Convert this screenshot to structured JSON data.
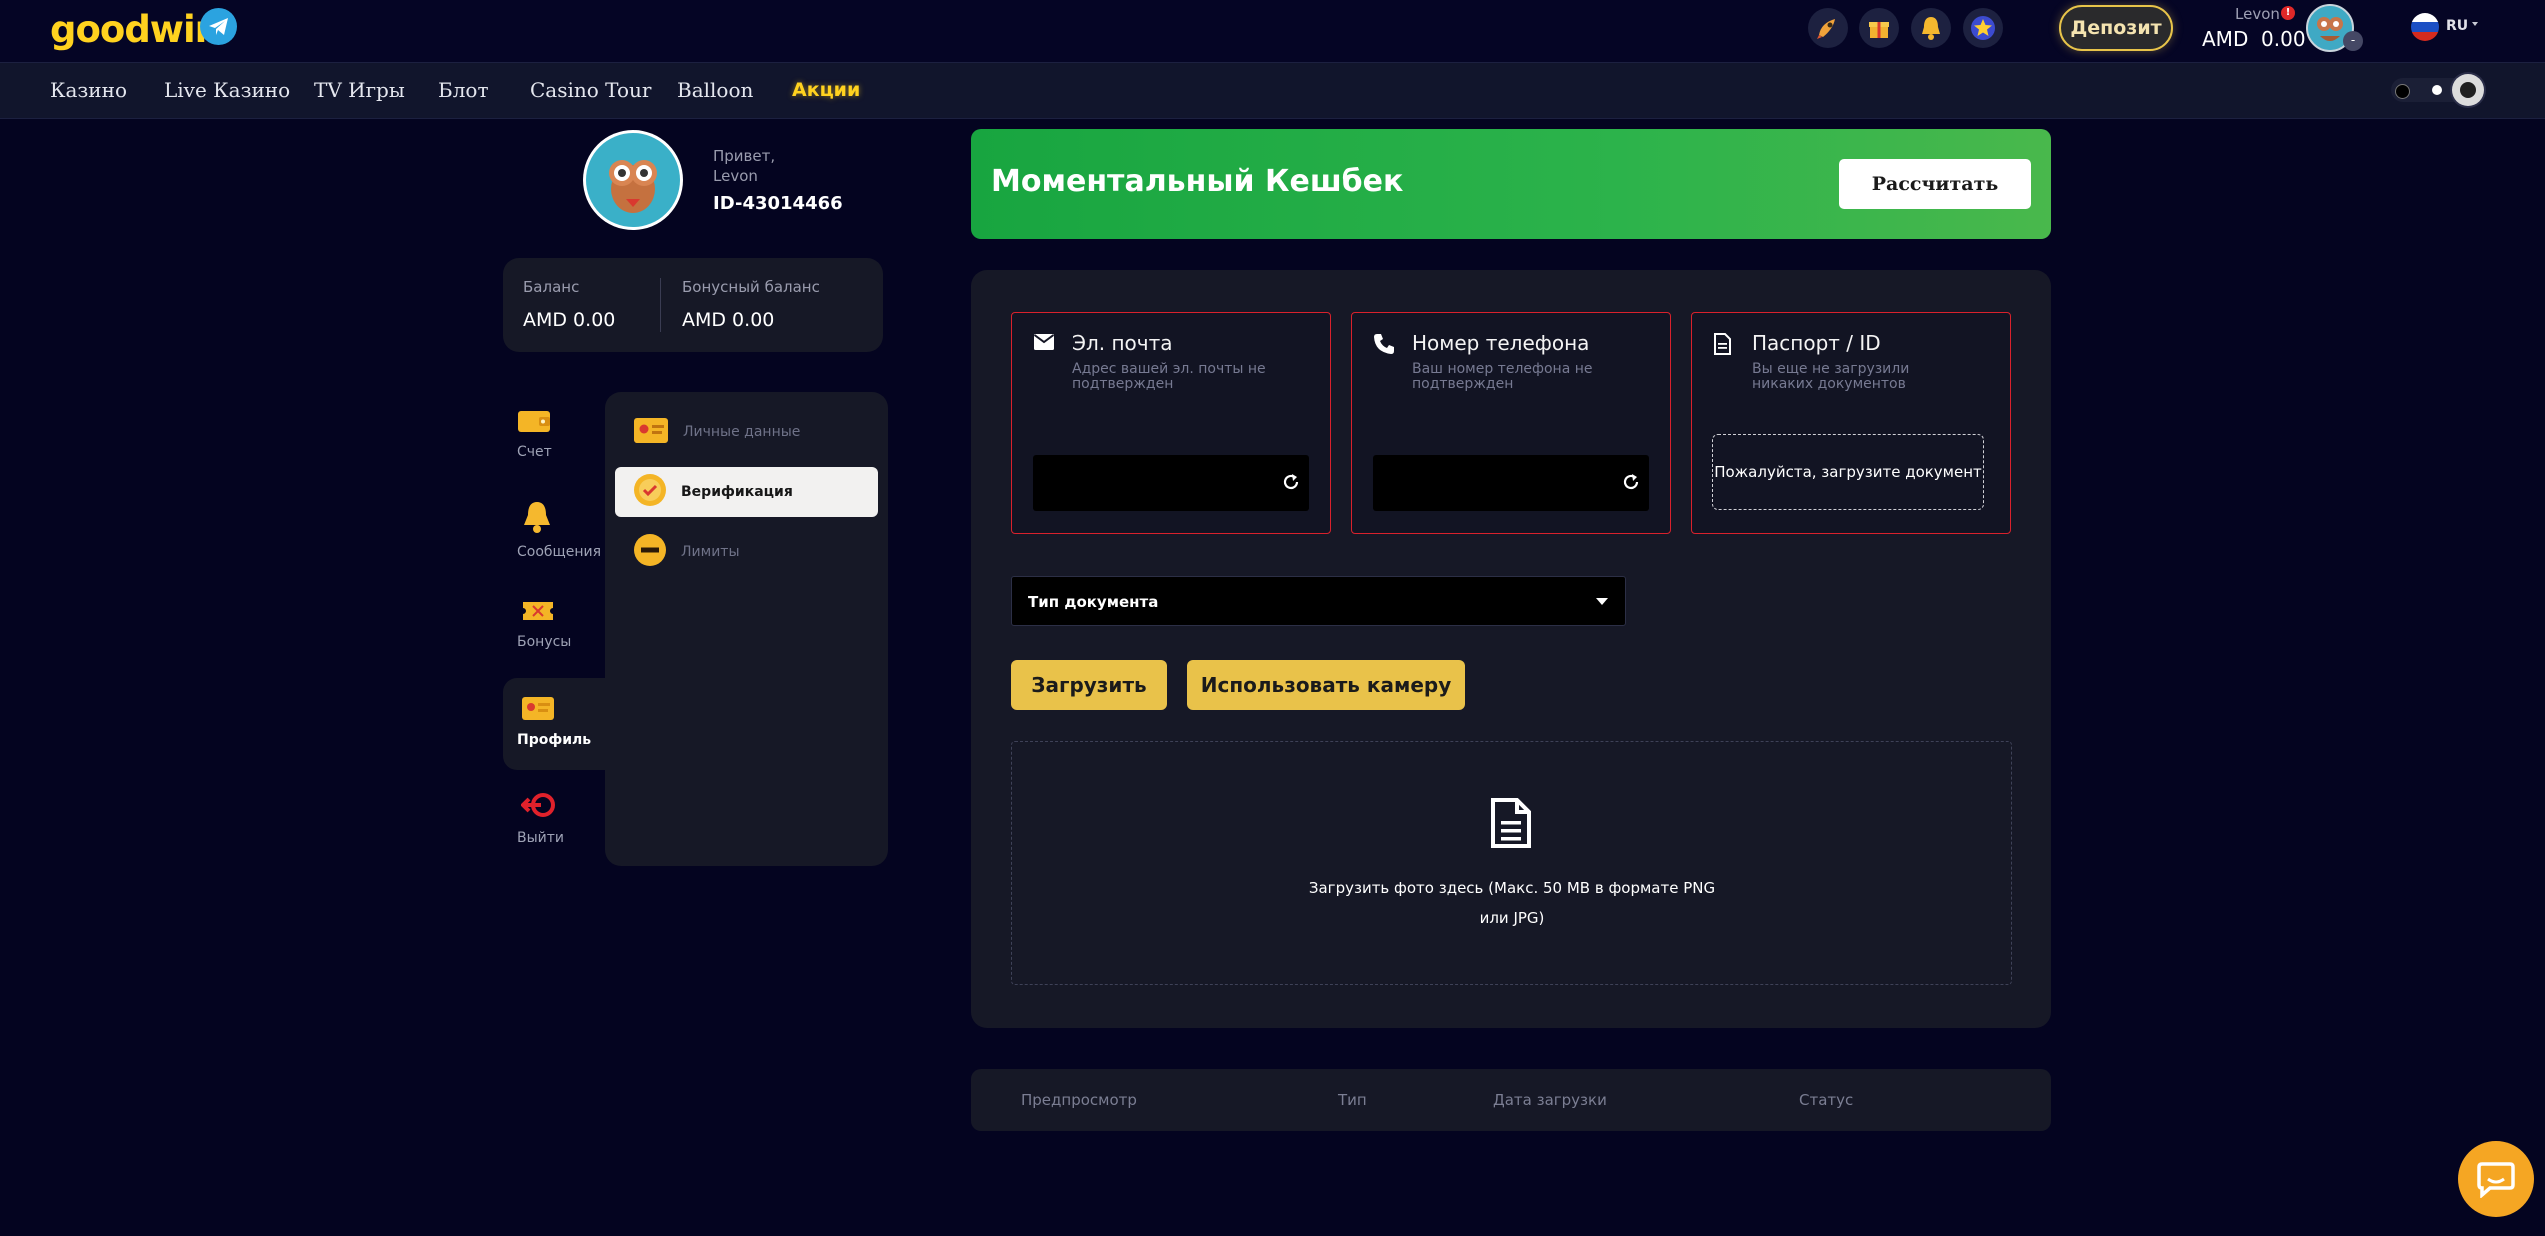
{
  "header": {
    "logo_text": "goodwin",
    "deposit_label": "Депозит",
    "username": "Levon",
    "balance": "AMD  0.00",
    "language": "RU"
  },
  "nav": {
    "items": [
      "Казино",
      "Live Казино",
      "TV Игры",
      "Блот",
      "Casino Tour",
      "Balloon",
      "Акции"
    ]
  },
  "profile": {
    "greeting": "Привет,",
    "name": "Levon",
    "id": "ID-43014466",
    "balance_label": "Баланс",
    "balance_value": "AMD 0.00",
    "bonus_label": "Бонусный баланс",
    "bonus_value": "AMD 0.00"
  },
  "sidebar": {
    "items": [
      {
        "label": "Счет",
        "icon": "wallet-icon"
      },
      {
        "label": "Сообщения",
        "icon": "bell-icon"
      },
      {
        "label": "Бонусы",
        "icon": "ticket-icon"
      },
      {
        "label": "Профиль",
        "icon": "profile-card-icon"
      },
      {
        "label": "Выйти",
        "icon": "logout-icon"
      }
    ]
  },
  "submenu": {
    "items": [
      {
        "label": "Личные данные",
        "icon": "id-card-icon"
      },
      {
        "label": "Верификация",
        "icon": "verification-icon"
      },
      {
        "label": "Лимиты",
        "icon": "limit-icon"
      }
    ]
  },
  "cashback": {
    "title": "Моментальный Кешбек",
    "button": "Рассчитать"
  },
  "verification": {
    "email": {
      "title": "Эл. почта",
      "subtitle": "Адрес вашей эл. почты не подтвержден",
      "value": ""
    },
    "phone": {
      "title": "Номер телефона",
      "subtitle": "Ваш номер телефона не подтвержден",
      "value": ""
    },
    "passport": {
      "title": "Паспорт / ID",
      "subtitle": "Вы еще не загрузили никаких документов",
      "upload_label": "Пожалуйста, загрузите документ"
    }
  },
  "document": {
    "type_label": "Тип документа",
    "upload_button": "Загрузить",
    "camera_button": "Использовать камеру",
    "dropzone_line1": "Загрузить фото здесь (Макс. 50 MB в формате PNG",
    "dropzone_line2": "или JPG)"
  },
  "table": {
    "columns": [
      "Предпросмотр",
      "Тип",
      "Дата загрузки",
      "Статус"
    ]
  },
  "colors": {
    "accent_yellow": "#e9c24a",
    "cashback_green": "#1fa544",
    "alert_red": "#d9212c",
    "background": "#040420"
  }
}
